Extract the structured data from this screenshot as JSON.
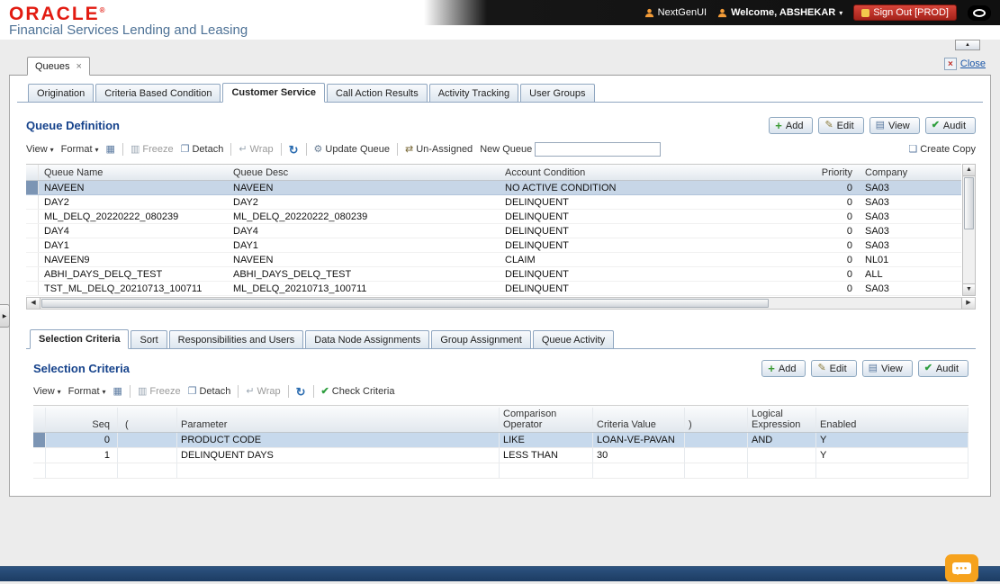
{
  "colors": {
    "oracle_red": "#e21b11",
    "title_blue": "#15428b",
    "selection_blue": "#c7d6e7",
    "footer_navy": "#1c3c63",
    "chat_orange": "#f6a21d",
    "signout_red": "#a5221a"
  },
  "header": {
    "logo": "ORACLE",
    "logo_reg": "®",
    "tagline": "Financial Services Lending and Leasing",
    "nextgen_label": "NextGenUI",
    "welcome_label": "Welcome, ABSHEKAR",
    "signout_label": "Sign Out [PROD]"
  },
  "workspace": {
    "doc_tab": "Queues",
    "doc_tab_close": "×",
    "close_label": "Close"
  },
  "main_tabs": {
    "items": [
      "Origination",
      "Criteria Based Condition",
      "Customer Service",
      "Call Action Results",
      "Activity Tracking",
      "User Groups"
    ],
    "active": "Customer Service"
  },
  "queue_definition": {
    "title": "Queue Definition",
    "buttons": {
      "add": "Add",
      "edit": "Edit",
      "view": "View",
      "audit": "Audit"
    },
    "toolbar": {
      "view": "View",
      "format": "Format",
      "freeze": "Freeze",
      "detach": "Detach",
      "wrap": "Wrap",
      "update_queue": "Update Queue",
      "unassigned": "Un-Assigned",
      "new_queue_label": "New Queue",
      "new_queue_value": "",
      "create_copy": "Create Copy"
    },
    "columns": [
      "Queue Name",
      "Queue Desc",
      "Account Condition",
      "Priority",
      "Company"
    ],
    "rows": [
      {
        "name": "NAVEEN",
        "desc": "NAVEEN",
        "condition": "NO ACTIVE CONDITION",
        "priority": "0",
        "company": "SA03"
      },
      {
        "name": "DAY2",
        "desc": "DAY2",
        "condition": "DELINQUENT",
        "priority": "0",
        "company": "SA03"
      },
      {
        "name": "ML_DELQ_20220222_080239",
        "desc": "ML_DELQ_20220222_080239",
        "condition": "DELINQUENT",
        "priority": "0",
        "company": "SA03"
      },
      {
        "name": "DAY4",
        "desc": "DAY4",
        "condition": "DELINQUENT",
        "priority": "0",
        "company": "SA03"
      },
      {
        "name": "DAY1",
        "desc": "DAY1",
        "condition": "DELINQUENT",
        "priority": "0",
        "company": "SA03"
      },
      {
        "name": "NAVEEN9",
        "desc": "NAVEEN",
        "condition": "CLAIM",
        "priority": "0",
        "company": "NL01"
      },
      {
        "name": "ABHI_DAYS_DELQ_TEST",
        "desc": "ABHI_DAYS_DELQ_TEST",
        "condition": "DELINQUENT",
        "priority": "0",
        "company": "ALL"
      },
      {
        "name": "TST_ML_DELQ_20210713_100711",
        "desc": "ML_DELQ_20210713_100711",
        "condition": "DELINQUENT",
        "priority": "0",
        "company": "SA03"
      }
    ]
  },
  "sub_tabs": {
    "items": [
      "Selection Criteria",
      "Sort",
      "Responsibilities and Users",
      "Data Node Assignments",
      "Group Assignment",
      "Queue Activity"
    ],
    "active": "Selection Criteria"
  },
  "selection_criteria": {
    "title": "Selection Criteria",
    "buttons": {
      "add": "Add",
      "edit": "Edit",
      "view": "View",
      "audit": "Audit"
    },
    "toolbar": {
      "view": "View",
      "format": "Format",
      "freeze": "Freeze",
      "detach": "Detach",
      "wrap": "Wrap",
      "check_criteria": "Check Criteria"
    },
    "columns": [
      "Seq",
      "(",
      "Parameter",
      "Comparison Operator",
      "Criteria Value",
      ")",
      "Logical Expression",
      "Enabled"
    ],
    "rows": [
      {
        "seq": "0",
        "open": "",
        "parameter": "PRODUCT CODE",
        "operator": "LIKE",
        "value": "LOAN-VE-PAVAN",
        "close": "",
        "logical": "AND",
        "enabled": "Y"
      },
      {
        "seq": "1",
        "open": "",
        "parameter": "DELINQUENT DAYS",
        "operator": "LESS THAN",
        "value": "30",
        "close": "",
        "logical": "",
        "enabled": "Y"
      }
    ]
  },
  "icons": {
    "add": "+",
    "edit": "✎",
    "view": "▤",
    "audit": "✔",
    "query": "▦",
    "freeze": "▥",
    "detach": "❐",
    "wrap": "↵",
    "refresh": "↻",
    "update_queue": "⚙",
    "unassigned": "⇄",
    "create_copy": "❏",
    "check_criteria": "✔",
    "dropdown_arrow": "▾",
    "welcome_caret": "▾",
    "collapse_up": "▲",
    "splitter_arrow": "▶",
    "scroll_up": "▲",
    "scroll_down": "▼",
    "scroll_left": "◀",
    "scroll_right": "▶",
    "chat_dots": "●●●"
  }
}
